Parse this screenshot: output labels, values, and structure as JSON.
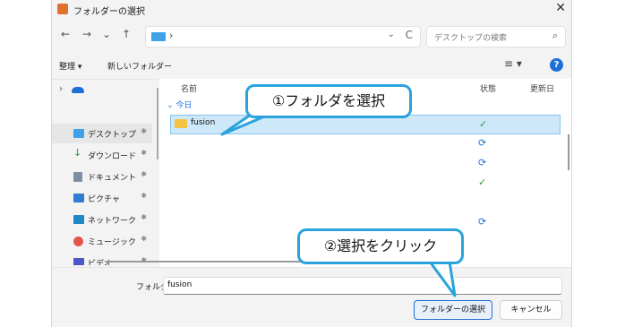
{
  "window": {
    "title": "フォルダーの選択",
    "close": "✕"
  },
  "nav": {
    "back": "←",
    "forward": "→",
    "recent": "⌄",
    "up": "↑",
    "addr_sep": "›",
    "addr_dropdown": "⌄",
    "refresh": "C"
  },
  "search": {
    "placeholder": "デスクトップの検索",
    "icon": "⌕"
  },
  "toolbar": {
    "organize": "整理 ▾",
    "new_folder": "新しいフォルダー",
    "view": "≡ ▾",
    "help": "?"
  },
  "sidebar": {
    "items": [
      {
        "label": "",
        "icon": "cloud-icon",
        "color": "#1f6fd8",
        "chev": "›"
      },
      {
        "label": "デスクトップ",
        "icon": "desktop-icon",
        "color": "#3fa2e8",
        "pin": "✱"
      },
      {
        "label": "ダウンロード",
        "icon": "download-icon",
        "color": "#2b9a3c",
        "pin": "✱"
      },
      {
        "label": "ドキュメント",
        "icon": "documents-icon",
        "color": "#7e8fa5",
        "pin": "✱"
      },
      {
        "label": "ピクチャ",
        "icon": "pictures-icon",
        "color": "#2f7dd1",
        "pin": "✱"
      },
      {
        "label": "ネットワーク",
        "icon": "network-icon",
        "color": "#1f86c8",
        "pin": "✱"
      },
      {
        "label": "ミュージック",
        "icon": "music-icon",
        "color": "#e2554a",
        "pin": "✱"
      },
      {
        "label": "ビデオ",
        "icon": "video-icon",
        "color": "#4b57c9",
        "pin": "✱"
      }
    ]
  },
  "content": {
    "columns": {
      "name": "名前",
      "status": "状態",
      "modified": "更新日"
    },
    "group": "⌄ 今日",
    "rows": [
      {
        "name": "fusion",
        "status": "✓"
      },
      {
        "name": "",
        "status": "⟳"
      },
      {
        "name": "",
        "status": "⟳"
      },
      {
        "name": "",
        "status": "✓"
      },
      {
        "name": "",
        "status": "⟳"
      }
    ]
  },
  "footer": {
    "folder_label": "フォルダー:",
    "folder_value": "fusion",
    "select_button": "フォルダーの選択",
    "cancel_button": "キャンセル"
  },
  "callouts": {
    "step1": "①フォルダを選択",
    "step2": "②選択をクリック"
  },
  "colors": {
    "accent": "#1f6fd8",
    "callout_border": "#2aa3dc",
    "selected_row": "#cde8f9"
  }
}
